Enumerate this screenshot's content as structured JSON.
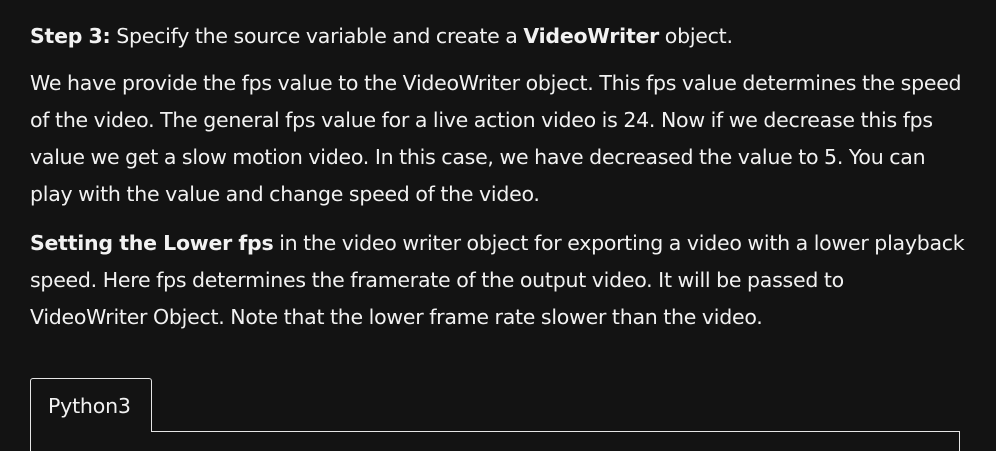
{
  "step": {
    "label": "Step 3:",
    "text_before": " Specify the source variable and create a ",
    "object_name": "VideoWriter",
    "text_after": " object."
  },
  "paragraph1": "We have provide the fps value to the VideoWriter object. This fps value determines the speed of the video. The general fps value for a live action video is 24. Now if we decrease this fps value we get a slow motion video. In this case, we have decreased the value to 5. You can play with the value and change speed of the video.",
  "paragraph2": {
    "bold": "Setting the Lower fps",
    "text": " in the video writer object for exporting a video with a lower playback speed. Here fps determines the framerate of the output video. It will be passed to VideoWriter Object.  Note that the lower frame rate slower than the video."
  },
  "code_tab": {
    "label": "Python3"
  }
}
